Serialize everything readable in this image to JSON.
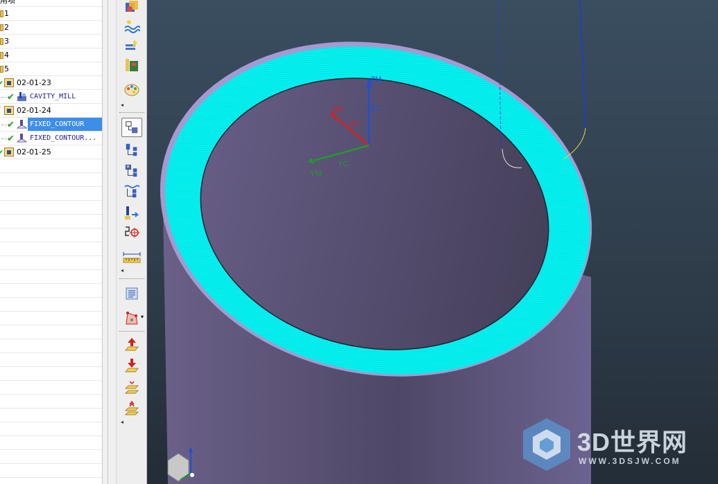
{
  "navigator": {
    "header_label": "用项",
    "rows": [
      {
        "label": "1"
      },
      {
        "label": "2"
      },
      {
        "label": "3"
      },
      {
        "label": "4"
      },
      {
        "label": "5"
      },
      {
        "label": "02-01-23"
      },
      {
        "label": "CAVITY_MILL"
      },
      {
        "label": "02-01-24"
      },
      {
        "label": "FIXED_CONTOUR"
      },
      {
        "label": "FIXED_CONTOUR..."
      },
      {
        "label": "02-01-25"
      }
    ]
  },
  "toolbar": {
    "icons": [
      "create-geometry-icon",
      "create-method-icon",
      "create-tool-icon",
      "library-icon",
      "palette-icon",
      "program-order-view-icon",
      "machine-tool-view-icon",
      "geometry-view-icon",
      "machining-method-view-icon",
      "tool-path-icon",
      "operation-move-icon",
      "measure-icon",
      "shop-docs-icon",
      "verify-toolpath-icon",
      "move-up-icon",
      "move-down-icon",
      "stack-up-icon",
      "stack-down-icon"
    ]
  },
  "viewport": {
    "axes": {
      "zm": "ZM",
      "zc": "ZC",
      "xm": "XM",
      "xc": "XC",
      "ym": "YM",
      "yc": "YC"
    },
    "colors": {
      "part": "#5f5577",
      "toolpath": "#00f2f0",
      "background_top": "#3a4e61",
      "background_bottom": "#232d37",
      "axis_z": "#1e4fd8",
      "axis_x": "#d62020",
      "axis_y": "#1f9b2d"
    }
  },
  "watermark": {
    "text": "3D世界网",
    "url": "WWW.3DSJW.COM"
  }
}
